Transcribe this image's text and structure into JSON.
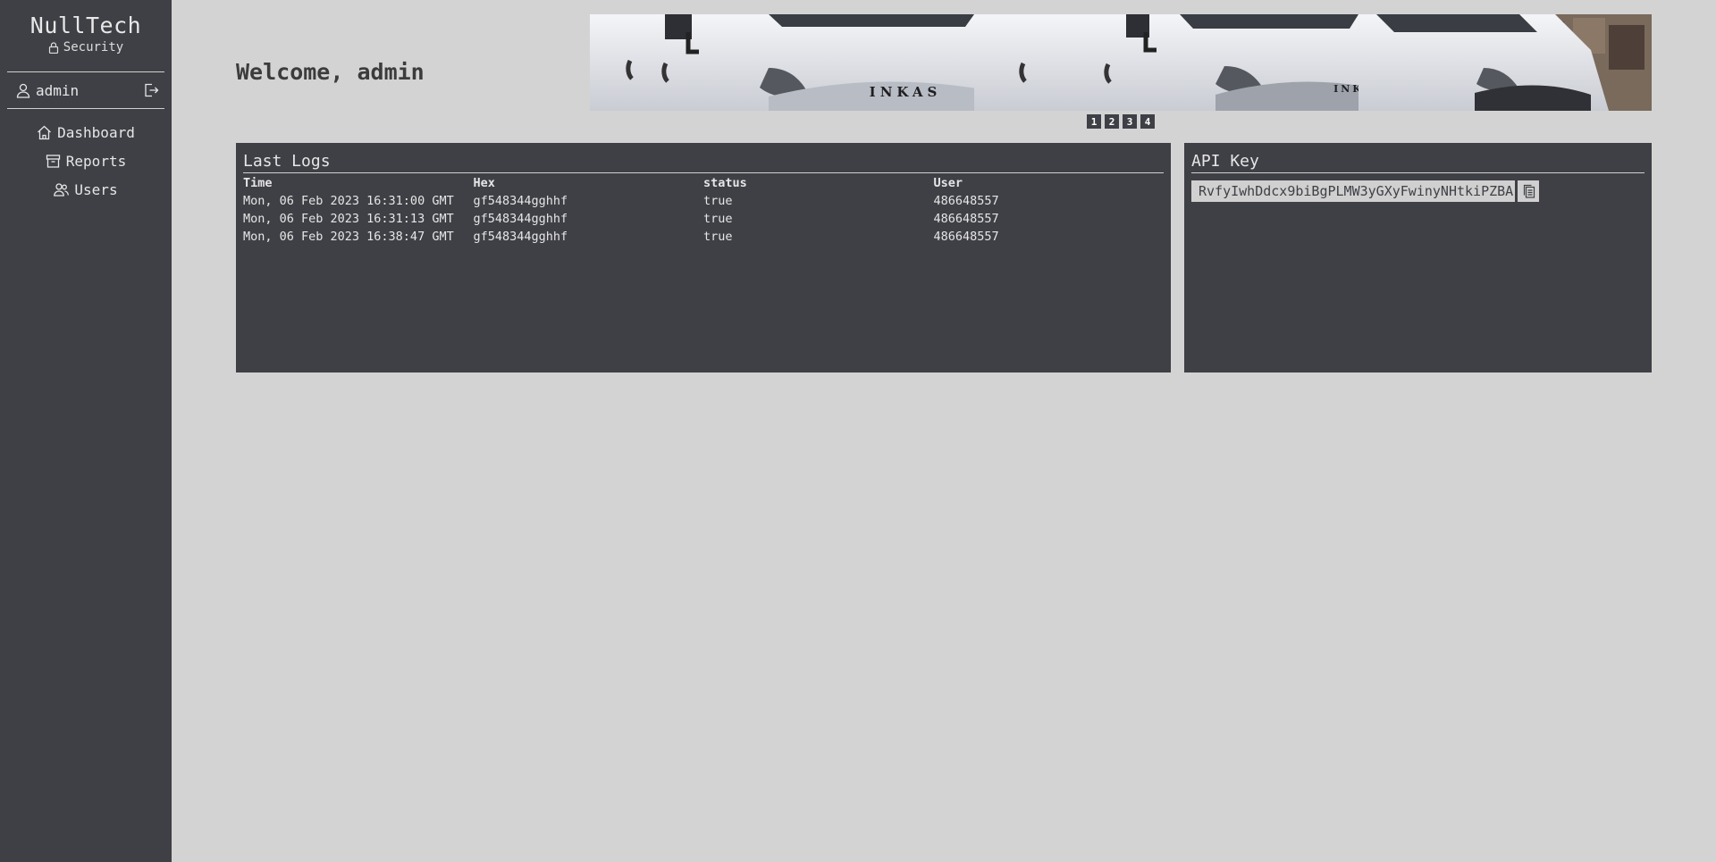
{
  "brand": {
    "name": "NullTech",
    "subtitle": "Security"
  },
  "user": {
    "name": "admin"
  },
  "nav": [
    {
      "label": "Dashboard",
      "icon": "home-icon"
    },
    {
      "label": "Reports",
      "icon": "archive-icon"
    },
    {
      "label": "Users",
      "icon": "users-icon"
    }
  ],
  "welcome": "Welcome, admin",
  "banner": {
    "brand_text": "INKAS",
    "pages": [
      "1",
      "2",
      "3",
      "4"
    ]
  },
  "logs": {
    "title": "Last Logs",
    "columns": [
      "Time",
      "Hex",
      "status",
      "User"
    ],
    "rows": [
      [
        "Mon, 06 Feb 2023 16:31:00 GMT",
        "gf548344gghhf",
        "true",
        "486648557"
      ],
      [
        "Mon, 06 Feb 2023 16:31:13 GMT",
        "gf548344gghhf",
        "true",
        "486648557"
      ],
      [
        "Mon, 06 Feb 2023 16:38:47 GMT",
        "gf548344gghhf",
        "true",
        "486648557"
      ]
    ]
  },
  "api": {
    "title": "API Key",
    "key": "RvfyIwhDdcx9biBgPLMW3yGXyFwinyNHtkiPZBA",
    "copy_icon": "copy-icon"
  },
  "colors": {
    "sidebar": "#3f4046",
    "background": "#d3d3d3",
    "panel": "#3f4046"
  }
}
